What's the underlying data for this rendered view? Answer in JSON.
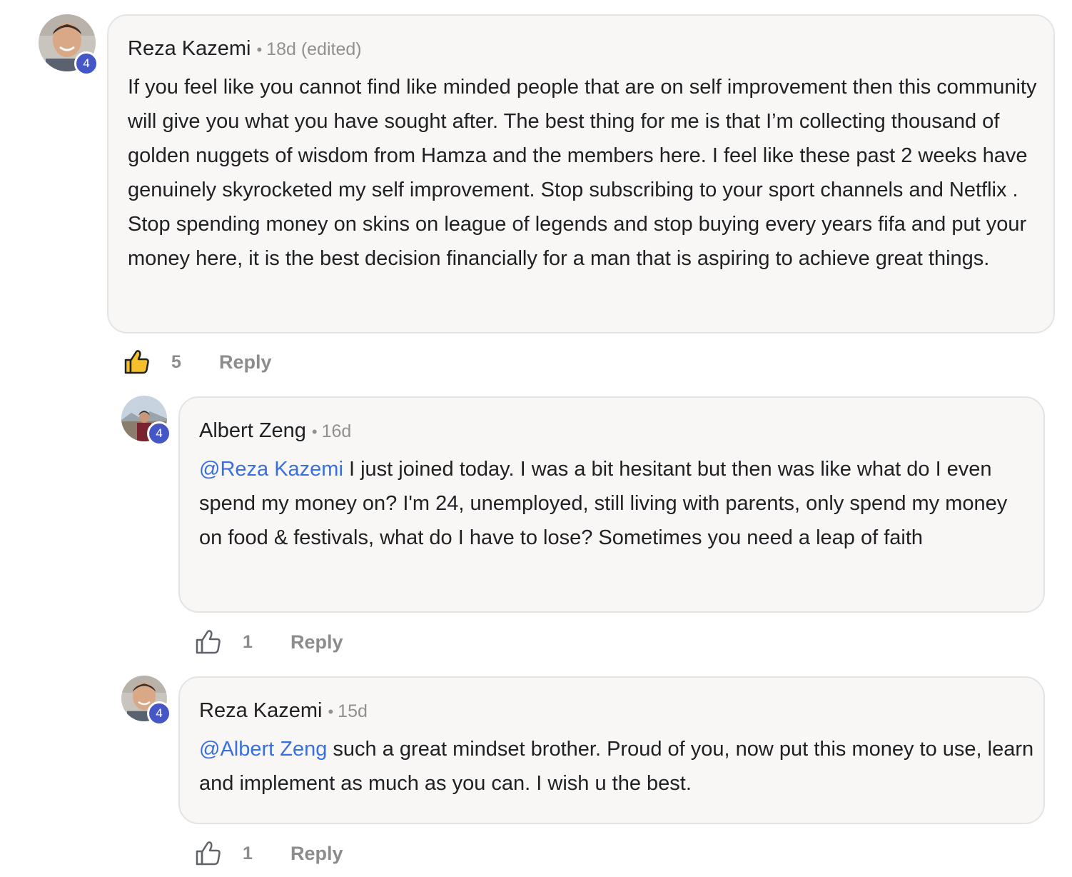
{
  "comments": [
    {
      "author": "Reza Kazemi",
      "separator": "•",
      "time": "18d (edited)",
      "level": "4",
      "body": "If you feel like you cannot find like minded people that are on self improvement then this community will give you what you have sought after. The best thing for me is that I’m collecting thousand of golden nuggets of wisdom from Hamza and the members here. I feel like these past 2 weeks have genuinely skyrocketed my self improvement. Stop subscribing to your sport channels and Netflix . Stop spending money on skins on league of legends and stop buying every years fifa and put your money here, it is the best decision financially for a man that is aspiring to achieve great things.",
      "likes": "5",
      "liked": true,
      "reply_label": "Reply"
    },
    {
      "author": "Albert Zeng",
      "separator": "•",
      "time": "16d",
      "level": "4",
      "mention": "@Reza Kazemi",
      "body": " I just joined today. I was a bit hesitant but then was like what do I even spend my money on? I'm 24, unemployed, still living with parents, only spend my money on food & festivals, what do I have to lose? Sometimes you need a leap of faith",
      "likes": "1",
      "liked": false,
      "reply_label": "Reply"
    },
    {
      "author": "Reza Kazemi",
      "separator": "•",
      "time": "15d",
      "level": "4",
      "mention": "@Albert Zeng",
      "body": " such a great mindset brother. Proud of you, now put this money to use, learn and implement as much as you can. I wish u the best.",
      "likes": "1",
      "liked": false,
      "reply_label": "Reply"
    }
  ],
  "colors": {
    "mention": "#3a6fe0",
    "badge": "#4457c4",
    "like_active": "#f5c02b",
    "bubble_bg": "#f8f7f5"
  },
  "icons": {
    "like": "thumbs-up-icon"
  }
}
